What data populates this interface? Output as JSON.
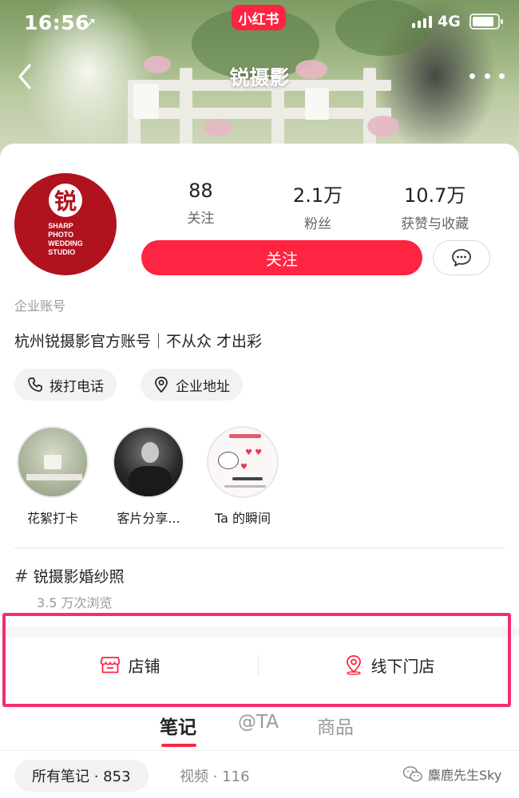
{
  "status_bar": {
    "time": "16:56",
    "app_logo": "小红书",
    "network": "4G"
  },
  "nav": {
    "title": "锐摄影"
  },
  "profile": {
    "avatar_mark": "锐",
    "avatar_text_lines": [
      "SHARP",
      "PHOTO",
      "WEDDING",
      "STUDIO"
    ],
    "stats": [
      {
        "value": "88",
        "label": "关注"
      },
      {
        "value": "2.1万",
        "label": "粉丝"
      },
      {
        "value": "10.7万",
        "label": "获赞与收藏"
      }
    ],
    "follow_label": "关注",
    "account_type": "企业账号",
    "bio": "杭州锐摄影官方账号｜不从众  才出彩"
  },
  "contact": {
    "call_label": "拨打电话",
    "address_label": "企业地址"
  },
  "highlights": [
    {
      "label": "花絮打卡"
    },
    {
      "label": "客片分享..."
    },
    {
      "label": "Ta 的瞬间"
    }
  ],
  "topic": {
    "name": "锐摄影婚纱照",
    "views": "3.5 万次浏览"
  },
  "shop": {
    "store_label": "店铺",
    "offline_label": "线下门店"
  },
  "tabs": [
    {
      "label": "笔记",
      "active": true
    },
    {
      "label": "@TA",
      "active": false
    },
    {
      "label": "商品",
      "active": false
    }
  ],
  "subtabs": {
    "all_notes": "所有笔记 · 853",
    "videos": "视频 · 116"
  },
  "watermark": "麋鹿先生Sky",
  "colors": {
    "accent": "#ff2442",
    "avatar_bg": "#b0121e",
    "highlight_box": "#f1316c"
  }
}
